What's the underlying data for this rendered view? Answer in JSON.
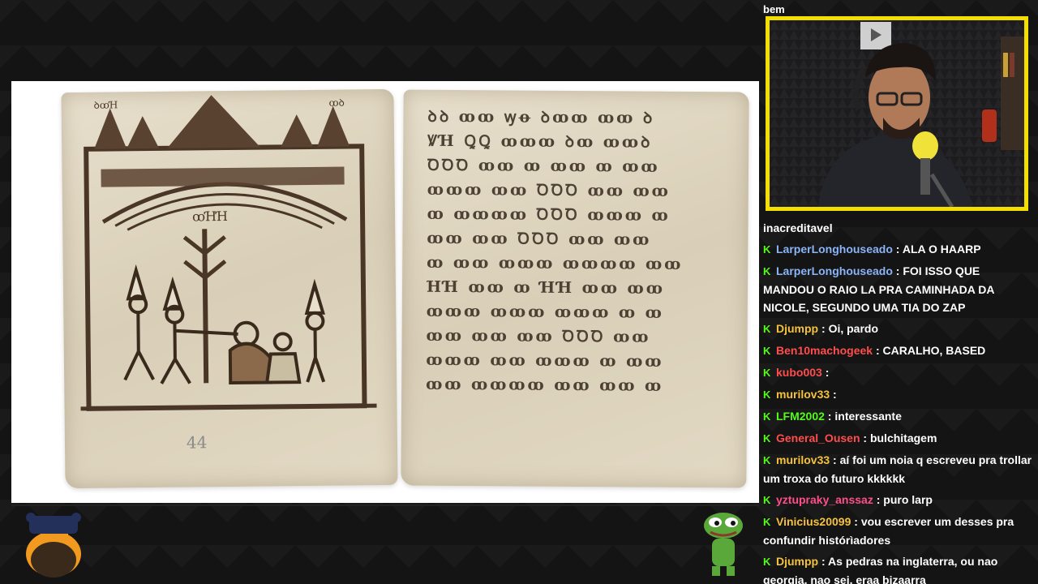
{
  "stream": {
    "top_chat_fragment": "bem",
    "content_description_icon": "manuscript-image",
    "manuscript_page_number": "44"
  },
  "manuscript": {
    "right_page_lines": [
      "ꝺꝺ ꝏꝏ ꝡꝋ ꝺꝏꝏ ꝏꝏ ꝺ",
      "ꝞꞪ ꝖꝖ ꝏꝏꝏ ꝺꝏ ꝏꝏꝺ",
      "ꝹꝹꝹ ꝏꝏ ꝏ ꝏꝏ ꝏ ꝏꝏ",
      "ꝏꝏꝏ ꝏꝏ ꝹꝹꝹ ꝏꝏ ꝏꝏ",
      "ꝏ ꝏꝏꝏꝏ ꝹꝹꝹ ꝏꝏꝏ ꝏ",
      "ꝏꝏ ꝏꝏ ꝹꝹꝹ ꝏꝏ ꝏꝏ",
      "ꝏ ꝏꝏ ꝏꝏꝏ ꝏꝏꝏꝏ ꝏꝏ",
      "ꞪꞪ ꝏꝏ ꝏ ꞪꞪ ꝏꝏ ꝏꝏ",
      "ꝏꝏꝏ ꝏꝏꝏ ꝏꝏꝏ ꝏ ꝏ",
      "ꝏꝏ ꝏꝏ ꝏꝏ ꝹꝹꝹ ꝏꝏ",
      "ꝏꝏꝏ ꝏꝏ ꝏꝏꝏ ꝏ ꝏꝏ",
      "ꝏꝏ ꝏꝏꝏꝏ ꝏꝏ ꝏꝏ ꝏ"
    ]
  },
  "chat": {
    "messages": [
      {
        "user": "",
        "user_color": "#ffffff",
        "text": "inacreditavel",
        "icon": ""
      },
      {
        "user": "LarperLonghouseado",
        "user_color": "#8ab4f8",
        "text": "ALA O HAARP",
        "icon": "K"
      },
      {
        "user": "LarperLonghouseado",
        "user_color": "#8ab4f8",
        "text": "FOI ISSO QUE MANDOU O RAIO LA PRA CAMINHADA DA NICOLE, SEGUNDO UMA TIA DO ZAP",
        "icon": "K"
      },
      {
        "user": "Djumpp",
        "user_color": "#f6c23e",
        "text": "Oi, pardo",
        "icon": "K"
      },
      {
        "user": "Ben10machogeek",
        "user_color": "#ff4d4d",
        "text": "CARALHO, BASED",
        "icon": "K"
      },
      {
        "user": "kubo003",
        "user_color": "#ff4d4d",
        "text": "",
        "icon": "K"
      },
      {
        "user": "murilov33",
        "user_color": "#f6c23e",
        "text": "",
        "icon": "K"
      },
      {
        "user": "LFM2002",
        "user_color": "#53fc18",
        "text": "interessante",
        "icon": "K"
      },
      {
        "user": "General_Ousen",
        "user_color": "#ff4d4d",
        "text": "bulchitagem",
        "icon": "K"
      },
      {
        "user": "murilov33",
        "user_color": "#f6c23e",
        "text": "aí foi um noia q escreveu pra trollar um troxa do futuro kkkkkk",
        "icon": "K"
      },
      {
        "user": "yztupraky_anssaz",
        "user_color": "#ff4d8a",
        "text": "puro larp",
        "icon": "K"
      },
      {
        "user": "Vinicius20099",
        "user_color": "#f6c23e",
        "text": "vou escrever um desses pra confundir histórìadores",
        "icon": "K"
      },
      {
        "user": "Djumpp",
        "user_color": "#f6c23e",
        "text": "As pedras na inglaterra, ou nao georgia, nao sei, eraa bizaarra",
        "icon": "K"
      }
    ]
  },
  "colors": {
    "webcam_border": "#f4dd00",
    "kick_green": "#53fc18",
    "background": "#141414"
  }
}
